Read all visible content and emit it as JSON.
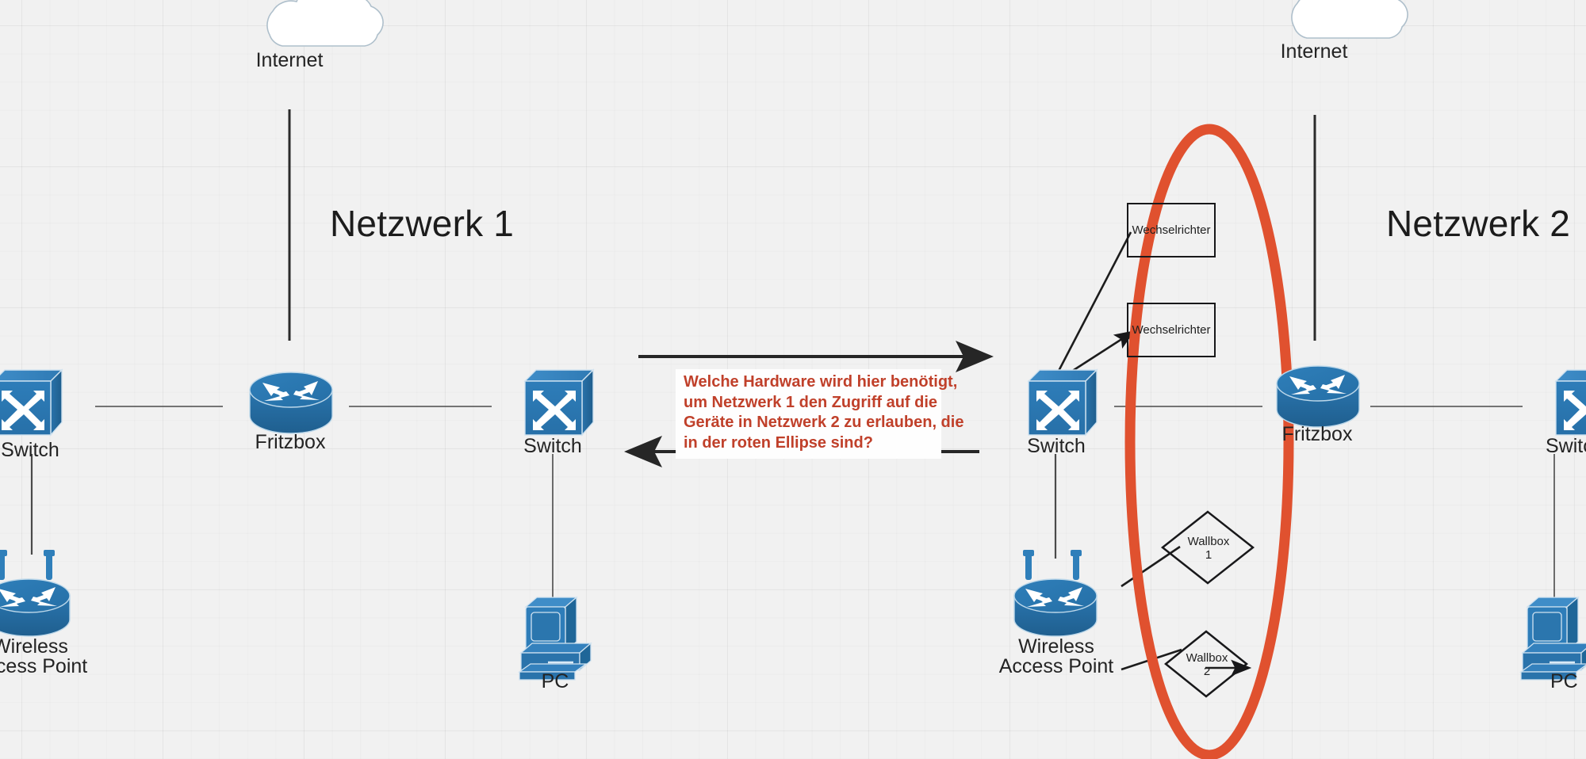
{
  "diagram": {
    "title_left": "Netzwerk 1",
    "title_right": "Netzwerk 2",
    "background_color": "#f1f1f1",
    "accent_red": "#c0402a",
    "ellipse_color": "#e0512f",
    "device_blue": "#2a7ab9",
    "device_blue_dark": "#1f6698"
  },
  "nodes": {
    "internet_left": {
      "label": "Internet",
      "icon": "cloud-icon"
    },
    "internet_right": {
      "label": "Internet",
      "icon": "cloud-icon"
    },
    "switch_left_edge": {
      "label": "Switch",
      "icon": "switch-icon"
    },
    "fritzbox_left": {
      "label": "Fritzbox",
      "icon": "router-icon"
    },
    "switch_net1": {
      "label": "Switch",
      "icon": "switch-icon"
    },
    "wap_left": {
      "label": "Wireless\nAccess Point",
      "label_line1": "Wireless",
      "label_line2": "Access Point",
      "icon": "wireless-access-point-icon"
    },
    "pc_net1": {
      "label": "PC",
      "icon": "pc-icon"
    },
    "switch_net2": {
      "label": "Switch",
      "icon": "switch-icon"
    },
    "wap_right": {
      "label_line1": "Wireless",
      "label_line2": "Access Point",
      "icon": "wireless-access-point-icon"
    },
    "fritzbox_right": {
      "label": "Fritzbox",
      "icon": "router-icon"
    },
    "switch_right_edge": {
      "label": "Switch",
      "icon": "switch-icon"
    },
    "pc_right_edge": {
      "label": "PC",
      "icon": "pc-icon"
    },
    "wechselrichter_1": {
      "label": "Wechselrichter",
      "shape": "rectangle"
    },
    "wechselrichter_2": {
      "label": "Wechselrichter",
      "shape": "rectangle"
    },
    "wallbox_1": {
      "label_line1": "Wallbox",
      "label_line2": "1",
      "shape": "diamond"
    },
    "wallbox_2": {
      "label_line1": "Wallbox",
      "label_line2": "2",
      "shape": "diamond"
    }
  },
  "annotation": {
    "line1": "Welche Hardware wird hier benötigt,",
    "line2": "um Netzwerk 1 den Zugriff auf die",
    "line3": "Geräte in Netzwerk 2 zu erlauben, die",
    "line4": "in der roten Ellipse sind?"
  },
  "connectors": {
    "arrow_top_direction": "right",
    "arrow_bottom_direction": "left"
  }
}
